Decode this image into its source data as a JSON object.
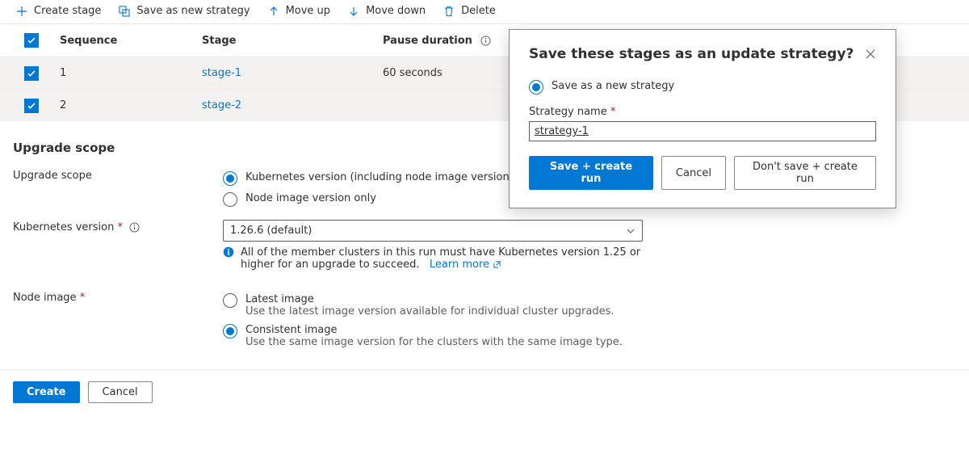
{
  "toolbar": {
    "create_stage": "Create stage",
    "save_as_new_strategy": "Save as new strategy",
    "move_up": "Move up",
    "move_down": "Move down",
    "delete": "Delete"
  },
  "columns": {
    "sequence": "Sequence",
    "stage": "Stage",
    "pause_duration": "Pause duration"
  },
  "rows": [
    {
      "sequence": "1",
      "stage": "stage-1",
      "pause": "60 seconds"
    },
    {
      "sequence": "2",
      "stage": "stage-2",
      "pause": ""
    }
  ],
  "upgrade_section_title": "Upgrade scope",
  "upgrade_scope": {
    "label": "Upgrade scope",
    "option_full": "Kubernetes version (including node image version)",
    "option_node": "Node image version only"
  },
  "k8s_version": {
    "label": "Kubernetes version",
    "value": "1.26.6 (default)",
    "note": "All of the member clusters in this run must have Kubernetes version 1.25 or higher for an upgrade to succeed.",
    "learn_more": "Learn more"
  },
  "node_image": {
    "label": "Node image",
    "opt_latest": "Latest image",
    "opt_latest_sub": "Use the latest image version available for individual cluster upgrades.",
    "opt_consistent": "Consistent image",
    "opt_consistent_sub": "Use the same image version for the clusters with the same image type."
  },
  "footer": {
    "create": "Create",
    "cancel": "Cancel"
  },
  "dialog": {
    "title": "Save these stages as an update strategy?",
    "option_save_new": "Save as a new strategy",
    "strategy_name_label": "Strategy name",
    "strategy_name_value": "strategy-1",
    "save_create": "Save + create run",
    "cancel": "Cancel",
    "dont_save": "Don't save + create run"
  }
}
